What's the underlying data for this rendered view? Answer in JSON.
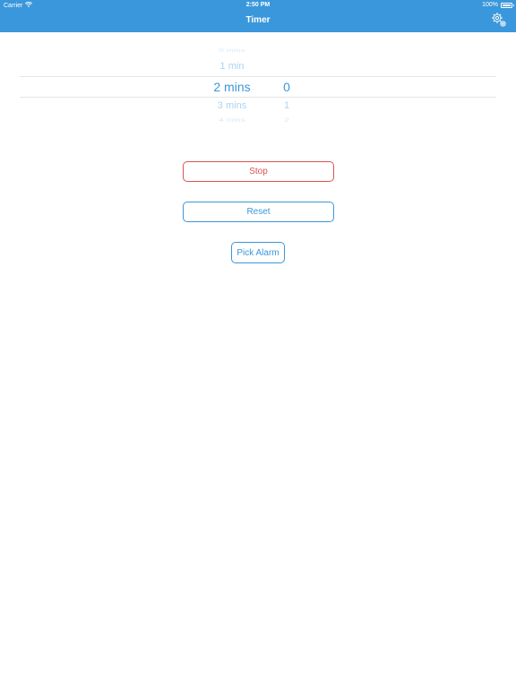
{
  "status_bar": {
    "carrier": "Carrier",
    "time": "2:50 PM",
    "battery": "100%"
  },
  "nav": {
    "title": "Timer"
  },
  "picker": {
    "minutes": [
      "0 mins",
      "1 min",
      "2 mins",
      "3 mins",
      "4 mins"
    ],
    "numbers": [
      "0",
      "1",
      "2"
    ],
    "selected_minutes": "2 mins",
    "selected_number": "0"
  },
  "buttons": {
    "stop": "Stop",
    "reset": "Reset",
    "pick_alarm": "Pick Alarm"
  },
  "colors": {
    "accent": "#3a97db",
    "stop": "#d9534f",
    "background": "#ffffff"
  },
  "icons": {
    "wifi": "wifi-icon",
    "battery": "battery-icon",
    "settings": "gear-icon"
  }
}
